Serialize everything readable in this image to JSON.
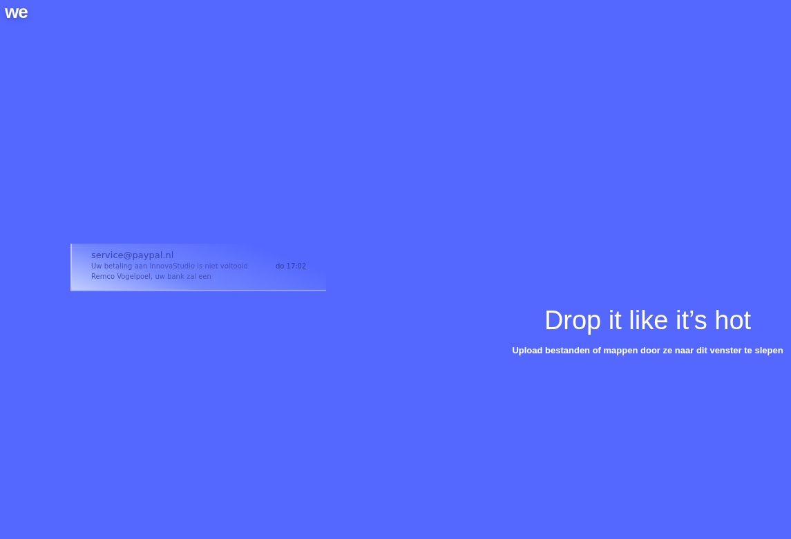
{
  "logo": {
    "text": "we"
  },
  "dragged_item": {
    "sender": "service@paypal.nl",
    "subject": "Uw betaling aan InnovaStudio is niet voltooid",
    "time": "do 17:02",
    "preview": "Remco Vogelpoel, uw bank zal een"
  },
  "drop_zone": {
    "title": "Drop it like it’s hot",
    "subtitle": "Upload bestanden of mappen door ze naar dit venster te slepen"
  }
}
